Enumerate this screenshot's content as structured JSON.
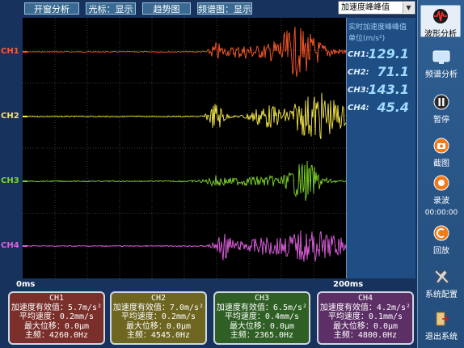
{
  "toolbar": {
    "window_analysis": "开窗分析",
    "cursor": "光标：显示",
    "trend": "趋势图",
    "spectrum": "频谱图：显示"
  },
  "mode_select": {
    "value": "加速度峰峰值"
  },
  "scope": {
    "channels": [
      {
        "label": "CH1",
        "color": "#ff5a2a"
      },
      {
        "label": "CH2",
        "color": "#f5e84a"
      },
      {
        "label": "CH3",
        "color": "#7ed62a"
      },
      {
        "label": "CH4",
        "color": "#e060e0"
      }
    ],
    "x_start": "0ms",
    "x_end": "200ms"
  },
  "readout": {
    "title": "实时加速度峰峰值",
    "unit": "单位(m/s²)",
    "rows": [
      {
        "label": "CH1:",
        "value": "129.1"
      },
      {
        "label": "CH2:",
        "value": "71.1"
      },
      {
        "label": "CH3:",
        "value": "143.1"
      },
      {
        "label": "CH4:",
        "value": "45.4"
      }
    ]
  },
  "channel_boxes": [
    {
      "title": "CH1",
      "rms": "加速度有效值：5.7m/s²",
      "vel": "平均速度：0.2mm/s",
      "disp": "最大位移：0.0μm",
      "freq": "主频：4260.0Hz",
      "color": "#7a2f2b"
    },
    {
      "title": "CH2",
      "rms": "加速度有效值：7.0m/s²",
      "vel": "平均速度：0.2mm/s",
      "disp": "最大位移：0.0μm",
      "freq": "主频：4545.0Hz",
      "color": "#6d6520"
    },
    {
      "title": "CH3",
      "rms": "加速度有效值：6.5m/s²",
      "vel": "平均速度：0.4mm/s",
      "disp": "最大位移：0.0μm",
      "freq": "主频：2365.0Hz",
      "color": "#2f5f24"
    },
    {
      "title": "CH4",
      "rms": "加速度有效值：4.2m/s²",
      "vel": "平均速度：0.1mm/s",
      "disp": "最大位移：0.0μm",
      "freq": "主频：4800.0Hz",
      "color": "#5c2f66"
    }
  ],
  "sidebar": {
    "waveform": "波形分析",
    "spectrum": "频谱分析",
    "pause": "暂停",
    "screenshot": "截图",
    "record": "录波",
    "record_time": "00:00:00",
    "playback": "回放",
    "config": "系统配置",
    "exit": "退出系统"
  }
}
